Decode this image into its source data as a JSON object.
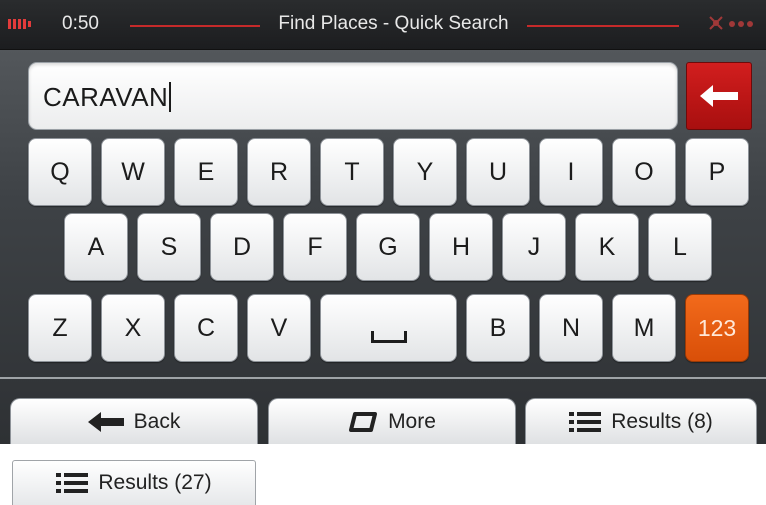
{
  "title_bar": {
    "clock": "0:50",
    "title": "Find Places - Quick Search",
    "battery_icon": "battery-icon",
    "status_icons": [
      "satellite-icon",
      "signal-dots-icon"
    ]
  },
  "search": {
    "value": "CARAVAN",
    "backspace_icon": "arrow-left-icon"
  },
  "keyboard": {
    "row1": [
      "Q",
      "W",
      "E",
      "R",
      "T",
      "Y",
      "U",
      "I",
      "O",
      "P"
    ],
    "row2": [
      "A",
      "S",
      "D",
      "F",
      "G",
      "H",
      "J",
      "K",
      "L"
    ],
    "row3": [
      "Z",
      "X",
      "C",
      "V",
      "B",
      "N",
      "M"
    ],
    "space_icon": "space-bar-icon",
    "numeric_label": "123"
  },
  "bottom_bar": {
    "back_label": "Back",
    "more_label": "More",
    "results_label": "Results (8)"
  },
  "extra": {
    "results_label": "Results (27)"
  },
  "colors": {
    "accent_red": "#c62a2a",
    "numeric_key": "#e85a10",
    "background": "#3e4246"
  }
}
